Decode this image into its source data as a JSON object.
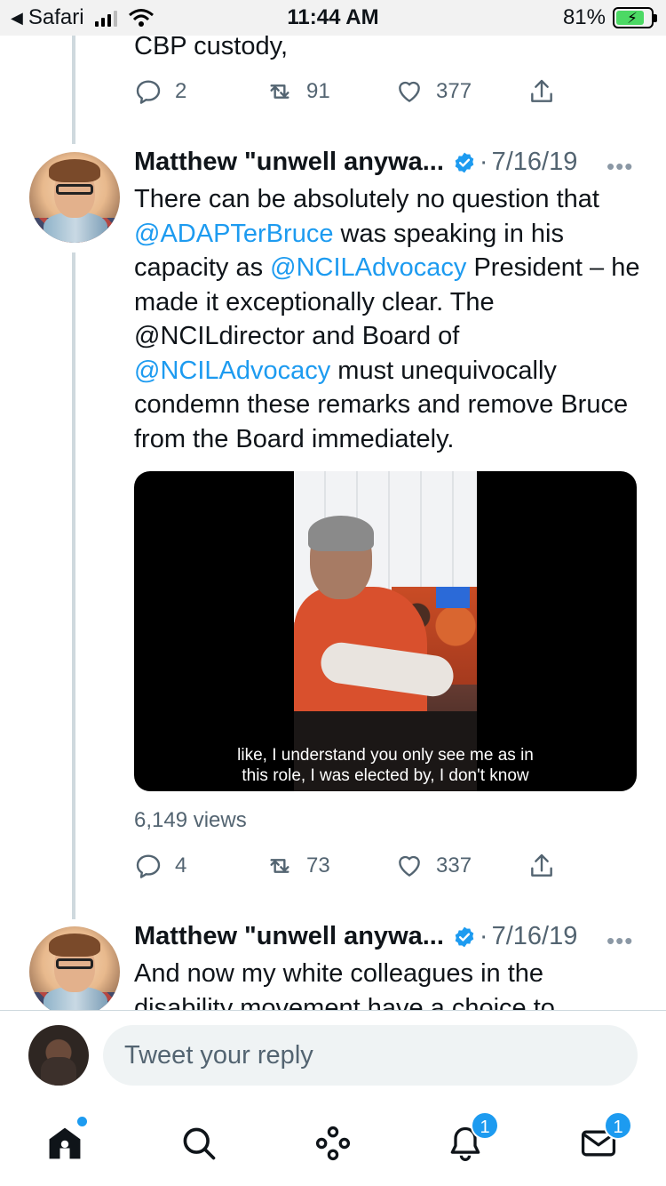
{
  "status_bar": {
    "back_label": "Safari",
    "time": "11:44 AM",
    "battery": "81%"
  },
  "previous_tweet": {
    "text_tail": "CBP custody,",
    "replies": "2",
    "retweets": "91",
    "likes": "377"
  },
  "tweets": [
    {
      "author": "Matthew \"unwell anywa...",
      "date": "7/16/19",
      "separator": "·",
      "more": "•••",
      "text": {
        "p1": "There can be absolutely no question that ",
        "m1": "@ADAPTerBruce",
        "p2": " was speaking in his capacity as ",
        "m2": "@NCILAdvocacy",
        "p3": " President – he made it exceptionally clear. The @NCILdirector and Board of ",
        "m3": "@NCILAdvocacy",
        "p4": " must unequivocally condemn these remarks and remove Bruce from the Board immediately."
      },
      "video_caption_line1": "like, I understand you only see me as in",
      "video_caption_line2": "this role, I was elected by, I don't know",
      "views": "6,149 views",
      "replies": "4",
      "retweets": "73",
      "likes": "337"
    },
    {
      "author": "Matthew \"unwell anywa...",
      "date": "7/16/19",
      "separator": "·",
      "more": "•••",
      "text_line1": "And now my white colleagues in the",
      "text_line2": "disability movement have a choice to"
    }
  ],
  "reply_box": {
    "placeholder": "Tweet your reply"
  },
  "tab_bar": {
    "notifications_badge": "1",
    "messages_badge": "1"
  },
  "colors": {
    "accent": "#1d9bf0",
    "secondary_text": "#536471",
    "thread_line": "#cfd9de"
  },
  "icons": [
    "reply-icon",
    "retweet-icon",
    "like-icon",
    "share-icon",
    "verified-icon",
    "home-icon",
    "search-icon",
    "spaces-icon",
    "notifications-icon",
    "messages-icon"
  ]
}
